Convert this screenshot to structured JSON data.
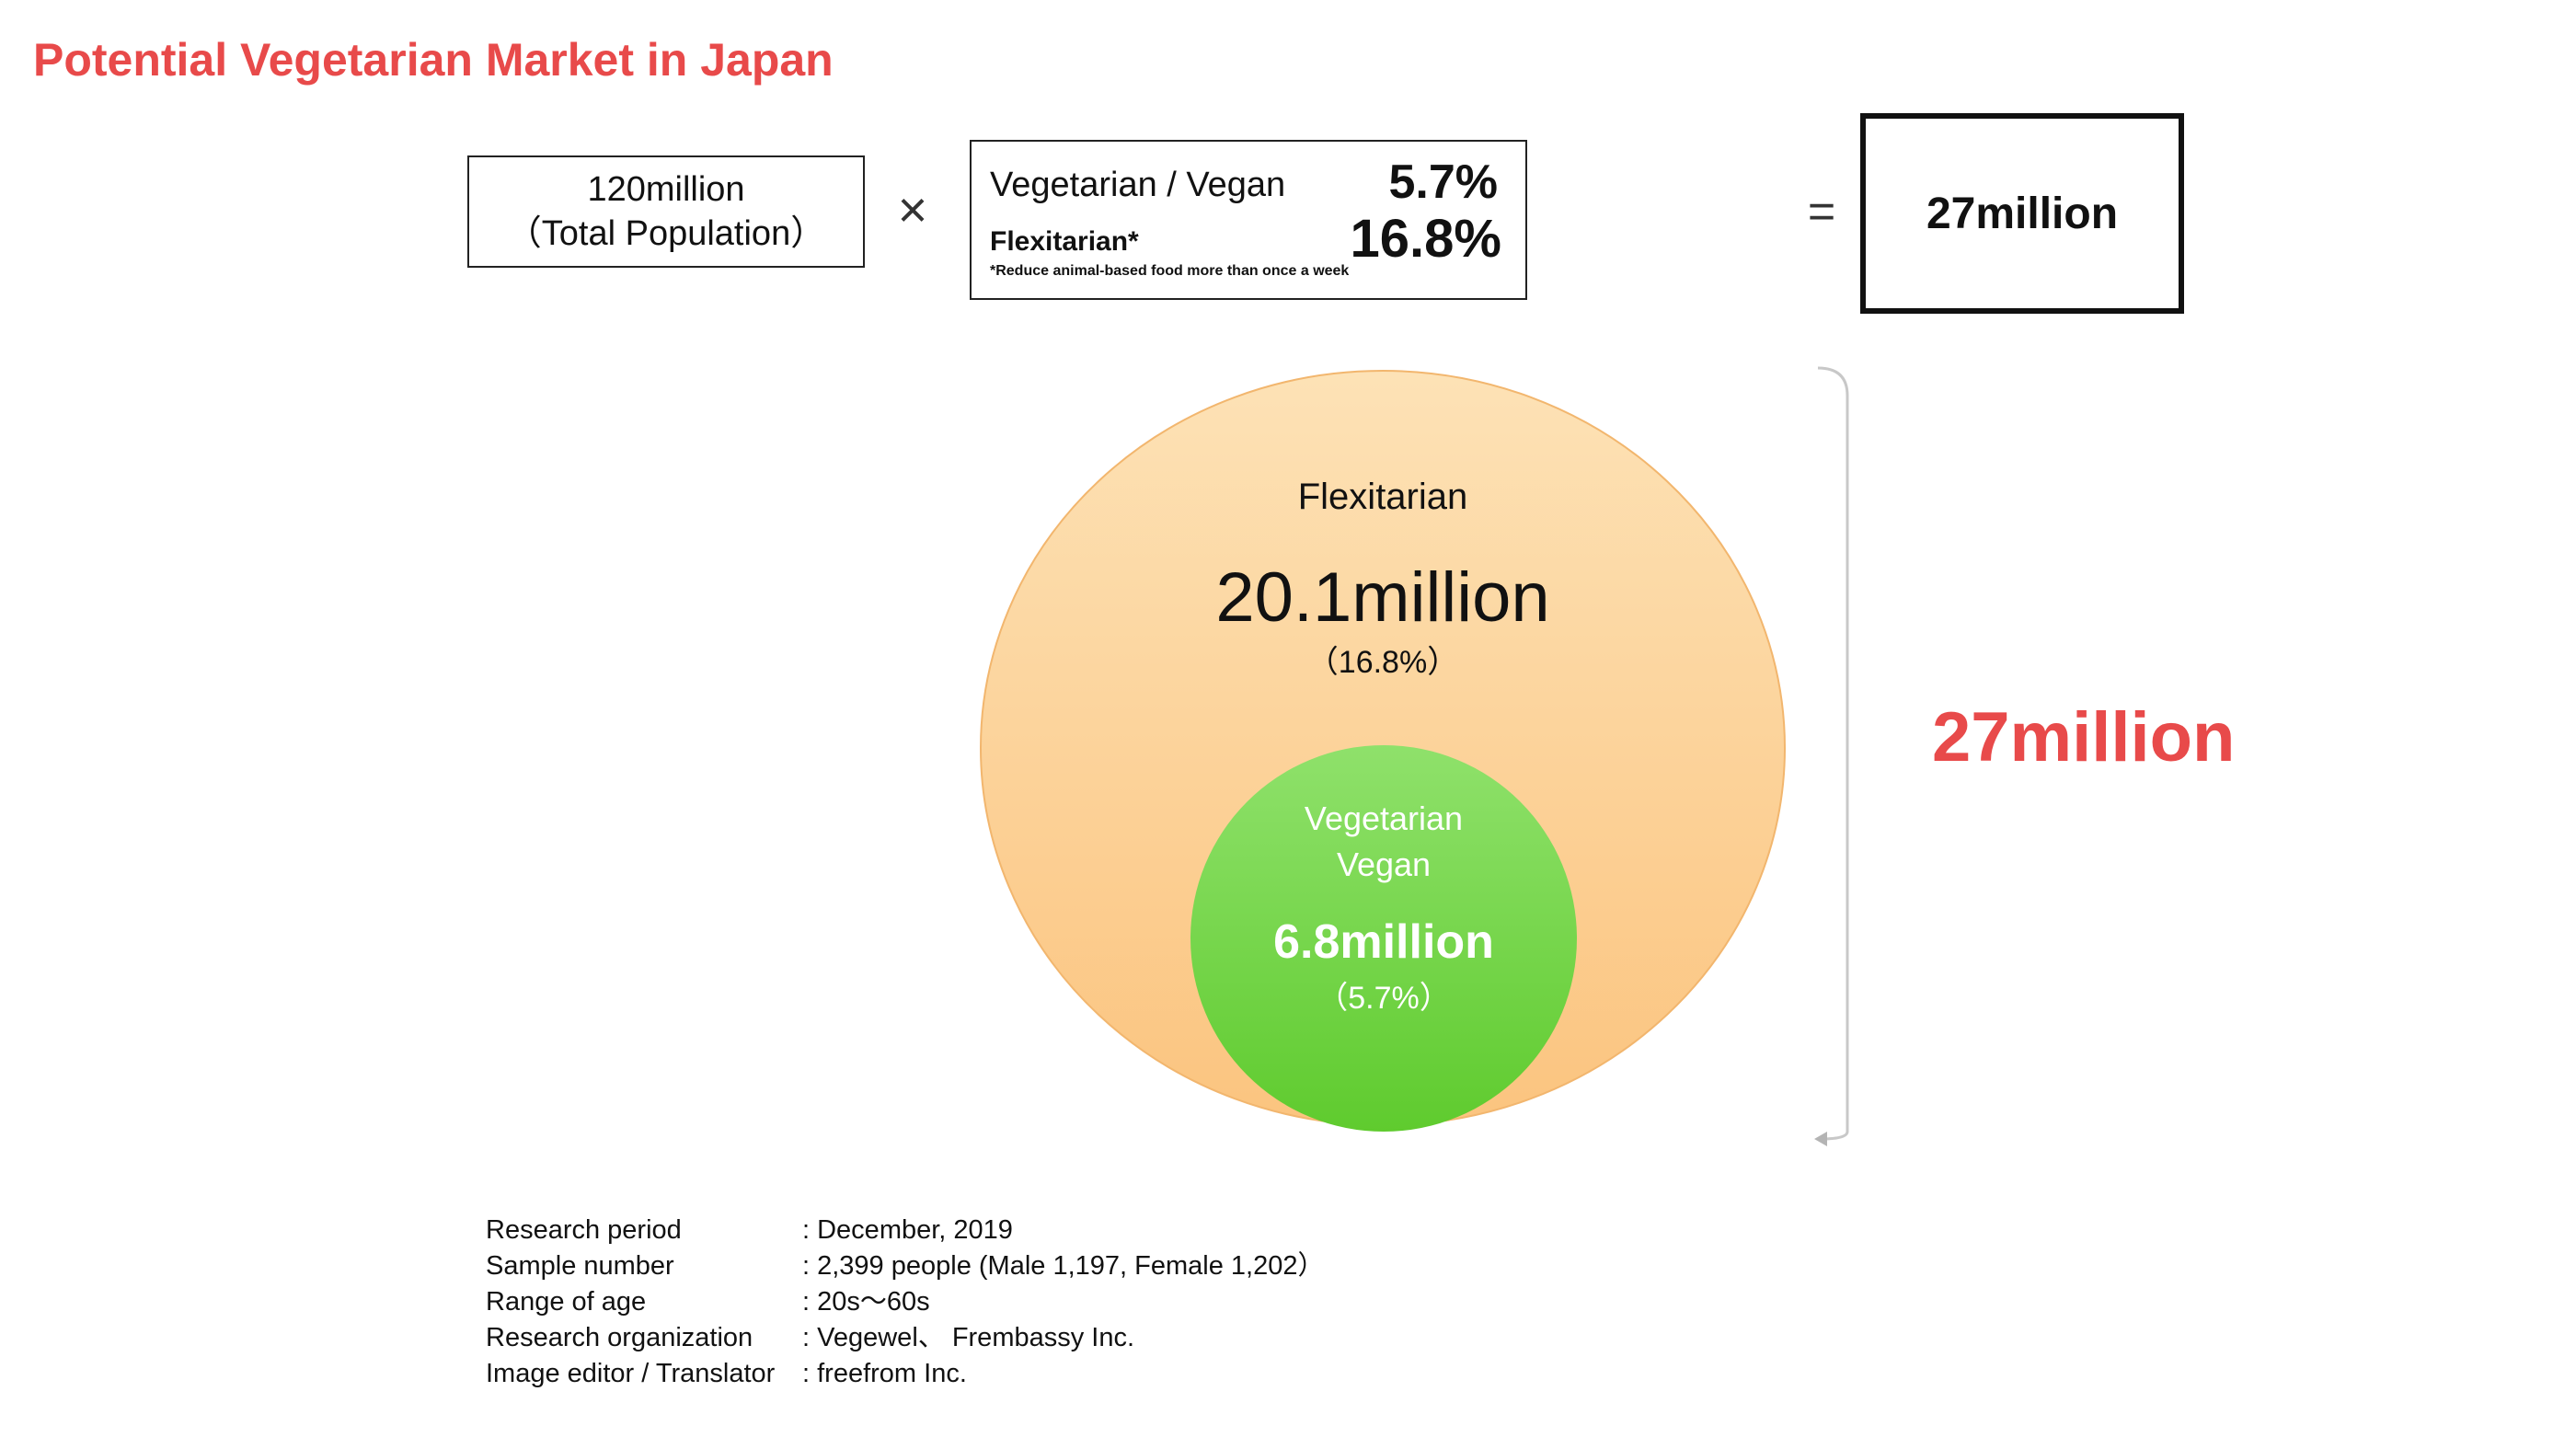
{
  "title": "Potential Vegetarian Market in Japan",
  "colors": {
    "title": "#e84a4a",
    "big_total": "#e84a4a",
    "flexitarian_circle_top": "#fde2b6",
    "flexitarian_circle_bottom": "#fbc47f",
    "vegan_circle_top": "#8fe16b",
    "vegan_circle_bottom": "#5fcb2e"
  },
  "equation": {
    "population": {
      "value": "120million",
      "label": "（Total Population）"
    },
    "times_symbol": "×",
    "rates": {
      "vegetarian_label": "Vegetarian / Vegan",
      "vegetarian_value": "5.7%",
      "flexitarian_label": "Flexitarian*",
      "flexitarian_value": "16.8%",
      "note": "*Reduce animal-based food more than once a week"
    },
    "equals_symbol": "=",
    "result": "27million"
  },
  "diagram": {
    "flexitarian": {
      "label": "Flexitarian",
      "value": "20.1million",
      "percent": "（16.8%）"
    },
    "vegetarian": {
      "label_line1": "Vegetarian",
      "label_line2": "Vegan",
      "value": "6.8million",
      "percent": "（5.7%）"
    },
    "total_label": "27million"
  },
  "research_info": [
    {
      "label": "Research period",
      "value": ": December, 2019"
    },
    {
      "label": "Sample number",
      "value": ": 2,399 people (Male 1,197, Female 1,202）"
    },
    {
      "label": "Range of age",
      "value": ": 20s〜60s"
    },
    {
      "label": "Research organization",
      "value": ": Vegewel、 Frembassy Inc."
    },
    {
      "label": "Image editor / Translator",
      "value": ": freefrom Inc."
    }
  ]
}
